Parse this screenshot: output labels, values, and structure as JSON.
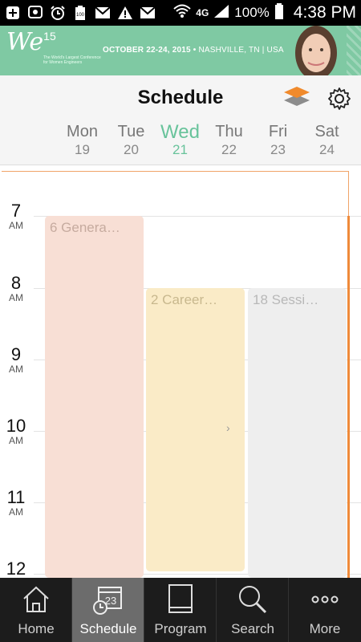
{
  "status_bar": {
    "battery_percent": "100%",
    "network": "4G",
    "time": "4:38 PM",
    "left_icons": [
      "add-icon",
      "messenger-icon",
      "alarm-icon",
      "battery-saver-icon",
      "gmail-icon",
      "warning-icon",
      "gmail-icon"
    ],
    "right_icons": [
      "wifi-icon",
      "network-4g-icon",
      "signal-icon",
      "battery-icon"
    ]
  },
  "banner": {
    "logo": "We",
    "logo_suffix": "15",
    "subtitle": "The World's Largest Conference for Women Engineers",
    "dates": "OCTOBER 22-24, 2015",
    "location": "NASHVILLE, TN | USA"
  },
  "header": {
    "title": "Schedule",
    "layers_icon": "layers-icon",
    "settings_icon": "gear-icon"
  },
  "days": [
    {
      "name": "Mon",
      "num": "19",
      "selected": false
    },
    {
      "name": "Tue",
      "num": "20",
      "selected": false
    },
    {
      "name": "Wed",
      "num": "21",
      "selected": true
    },
    {
      "name": "Thu",
      "num": "22",
      "selected": false
    },
    {
      "name": "Fri",
      "num": "23",
      "selected": false
    },
    {
      "name": "Sat",
      "num": "24",
      "selected": false
    }
  ],
  "hours": [
    {
      "num": "7",
      "ampm": "AM"
    },
    {
      "num": "8",
      "ampm": "AM"
    },
    {
      "num": "9",
      "ampm": "AM"
    },
    {
      "num": "10",
      "ampm": "AM"
    },
    {
      "num": "11",
      "ampm": "AM"
    },
    {
      "num": "12",
      "ampm": ""
    }
  ],
  "events": [
    {
      "label": "6 Genera…",
      "color": "#f8dfd5"
    },
    {
      "label": "2 Career…",
      "color": "#faebc7"
    },
    {
      "label": "18 Sessi…",
      "color": "#eeeeee"
    }
  ],
  "colors": {
    "brand_green": "#7fc9a3",
    "selected_day": "#68c39b",
    "now_line": "#ef8a3a"
  },
  "tabs": [
    {
      "label": "Home",
      "icon": "home-icon",
      "active": false
    },
    {
      "label": "Schedule",
      "icon": "calendar-icon",
      "active": true,
      "icon_text": "23"
    },
    {
      "label": "Program",
      "icon": "book-icon",
      "active": false
    },
    {
      "label": "Search",
      "icon": "search-icon",
      "active": false
    },
    {
      "label": "More",
      "icon": "more-icon",
      "active": false
    }
  ]
}
